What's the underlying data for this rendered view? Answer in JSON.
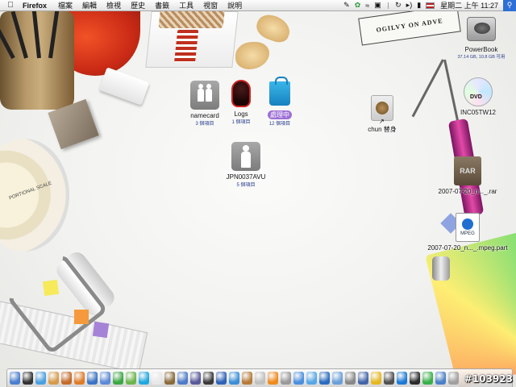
{
  "menubar": {
    "apple_icon": "apple-icon",
    "app_name": "Firefox",
    "menus": [
      "檔案",
      "編輯",
      "檢視",
      "歷史",
      "書籤",
      "工具",
      "視窗",
      "說明"
    ],
    "status_icons": [
      "script-icon",
      "leaf-icon",
      "wifi-icon",
      "display-icon",
      "bluetooth-icon",
      "sync-icon",
      "volume-icon",
      "battery-icon",
      "flag-icon"
    ],
    "clock": "星期二 上午 11:27",
    "spotlight_icon": "spotlight-icon"
  },
  "desktop": {
    "ogilvy_text": "OGILVY ON ADVE",
    "wheel_text": "PORTIONAL SCALE",
    "icons": [
      {
        "id": "namecard",
        "label": "namecard",
        "sub": "3 個項目",
        "icon": "folder-people-icon"
      },
      {
        "id": "logs",
        "label": "Logs",
        "sub": "1 個項目",
        "icon": "logs-folder-icon"
      },
      {
        "id": "processing",
        "label": "處理中",
        "sub": "12 個項目",
        "icon": "shopping-bag-icon"
      },
      {
        "id": "jpn",
        "label": "JPN0037AVU",
        "sub": "5 個項目",
        "icon": "folder-person-icon"
      },
      {
        "id": "chun",
        "label": "chun 替身",
        "sub": "",
        "icon": "alias-icon"
      },
      {
        "id": "powerbook",
        "label": "PowerBook",
        "sub": "37.14 GB, 10.8 GB 可用",
        "icon": "hard-drive-icon"
      },
      {
        "id": "dvd",
        "label": "INC05TW12",
        "sub": "",
        "icon": "dvd-icon"
      },
      {
        "id": "rar",
        "label": "2007-07-20_n..._.rar",
        "sub": "",
        "icon": "rar-archive-icon"
      },
      {
        "id": "mpeg",
        "label": "2007-07-20_n..._.mpeg.part",
        "sub": "",
        "icon": "mpeg-file-icon"
      }
    ]
  },
  "dock": {
    "items": [
      {
        "name": "finder-icon",
        "color": "#4a7fd0"
      },
      {
        "name": "dashboard-icon",
        "color": "#333333"
      },
      {
        "name": "safari-icon",
        "color": "#4aa0e0"
      },
      {
        "name": "itunes-icon",
        "color": "#d89b4a"
      },
      {
        "name": "address-book-icon",
        "color": "#c46a2a"
      },
      {
        "name": "firefox-icon",
        "color": "#e07b28"
      },
      {
        "name": "network-icon",
        "color": "#3b74c4"
      },
      {
        "name": "thunderbird-icon",
        "color": "#5b8ad8"
      },
      {
        "name": "ichat-icon",
        "color": "#3aa843"
      },
      {
        "name": "adium-icon",
        "color": "#6bb64c"
      },
      {
        "name": "skype-icon",
        "color": "#1fa8e0"
      },
      {
        "name": "calendar-icon",
        "color": "#e8e8e8"
      },
      {
        "name": "preview-icon",
        "color": "#8a6b3c"
      },
      {
        "name": "photo-icon",
        "color": "#4d7cc9"
      },
      {
        "name": "music-icon",
        "color": "#5a5a9a"
      },
      {
        "name": "movie-icon",
        "color": "#3a3a3a"
      },
      {
        "name": "quicktime-icon",
        "color": "#2f62b8"
      },
      {
        "name": "globe-icon",
        "color": "#3b8fd8"
      },
      {
        "name": "guitar-icon",
        "color": "#b87a38"
      },
      {
        "name": "torch-icon",
        "color": "#c0c0c0"
      },
      {
        "name": "vlc-icon",
        "color": "#f08a1c"
      },
      {
        "name": "crop-icon",
        "color": "#9a9a9a"
      },
      {
        "name": "play-icon",
        "color": "#4a90e0"
      },
      {
        "name": "safari-2-icon",
        "color": "#56a7e8"
      },
      {
        "name": "pen-tool-icon",
        "color": "#2a6cc0"
      },
      {
        "name": "mail-icon",
        "color": "#6aa0d8"
      },
      {
        "name": "gear-icon",
        "color": "#888888"
      },
      {
        "name": "user-icon",
        "color": "#4466aa"
      },
      {
        "name": "dollar-icon",
        "color": "#e6b820"
      },
      {
        "name": "dvd-player-icon",
        "color": "#505050"
      },
      {
        "name": "qq-icon",
        "color": "#1b7bd6"
      },
      {
        "name": "terminal-icon",
        "color": "#2b2b2b"
      },
      {
        "name": "chat-icon",
        "color": "#38b04a"
      },
      {
        "name": "download-icon",
        "color": "#4a80c8"
      },
      {
        "name": "trash-icon",
        "color": "#a0a0a0"
      }
    ]
  },
  "watermark": "#103923"
}
